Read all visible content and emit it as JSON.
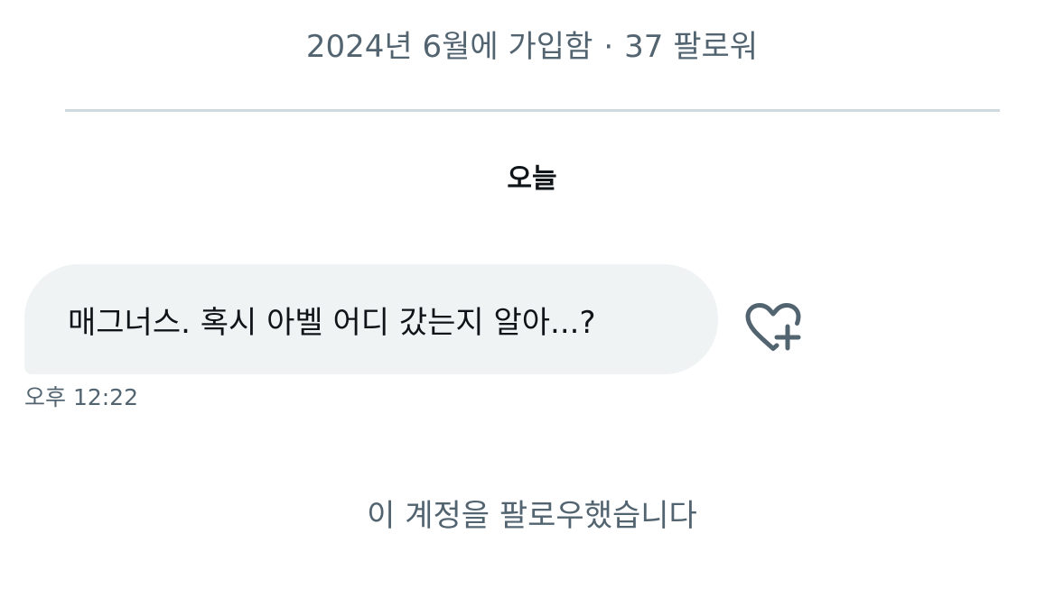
{
  "profile": {
    "joined": "2024년 6월에 가입함",
    "separator": "·",
    "followers": "37 팔로워"
  },
  "conversation": {
    "date_header": "오늘",
    "messages": [
      {
        "text": "매그너스. 혹시 아벨 어디 갔는지 알아...?",
        "time": "오후 12:22"
      }
    ],
    "system_note": "이 계정을 팔로우했습니다"
  },
  "icons": {
    "react": "heart-plus-icon"
  },
  "colors": {
    "bubble": "#eff3f4",
    "secondary_text": "#536471",
    "divider": "#cfd9de"
  }
}
